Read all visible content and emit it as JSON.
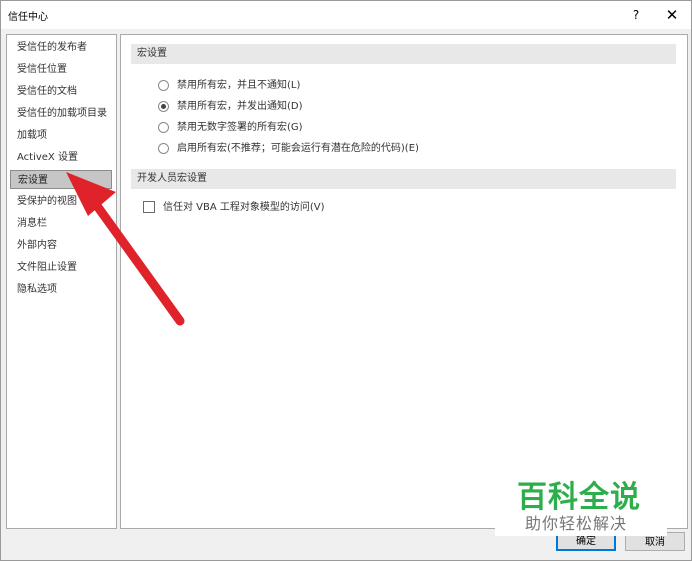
{
  "window": {
    "title": "信任中心",
    "help": "?",
    "close": "✕"
  },
  "sidebar": {
    "items": [
      {
        "label": "受信任的发布者"
      },
      {
        "label": "受信任位置"
      },
      {
        "label": "受信任的文档"
      },
      {
        "label": "受信任的加载项目录"
      },
      {
        "label": "加载项"
      },
      {
        "label": "ActiveX 设置"
      },
      {
        "label": "宏设置",
        "selected": true
      },
      {
        "label": "受保护的视图"
      },
      {
        "label": "消息栏"
      },
      {
        "label": "外部内容"
      },
      {
        "label": "文件阻止设置"
      },
      {
        "label": "隐私选项"
      }
    ]
  },
  "macro_settings": {
    "header": "宏设置",
    "options": [
      {
        "label": "禁用所有宏，并且不通知(L)",
        "checked": false
      },
      {
        "label": "禁用所有宏，并发出通知(D)",
        "checked": true
      },
      {
        "label": "禁用无数字签署的所有宏(G)",
        "checked": false
      },
      {
        "label": "启用所有宏(不推荐；可能会运行有潜在危险的代码)(E)",
        "checked": false
      }
    ]
  },
  "developer": {
    "header": "开发人员宏设置",
    "vba_trust_label": "信任对 VBA 工程对象模型的访问(V)",
    "vba_trust_checked": false
  },
  "footer": {
    "ok": "确定",
    "cancel": "取消"
  },
  "watermark": {
    "title": "百科全说",
    "subtitle": "助你轻松解决"
  },
  "colors": {
    "arrow": "#e0232b",
    "selected_bg": "#c6c6c6",
    "watermark_green": "#2eae4a"
  },
  "icons": [
    "help-icon",
    "close-icon",
    "red-arrow-annotation"
  ]
}
